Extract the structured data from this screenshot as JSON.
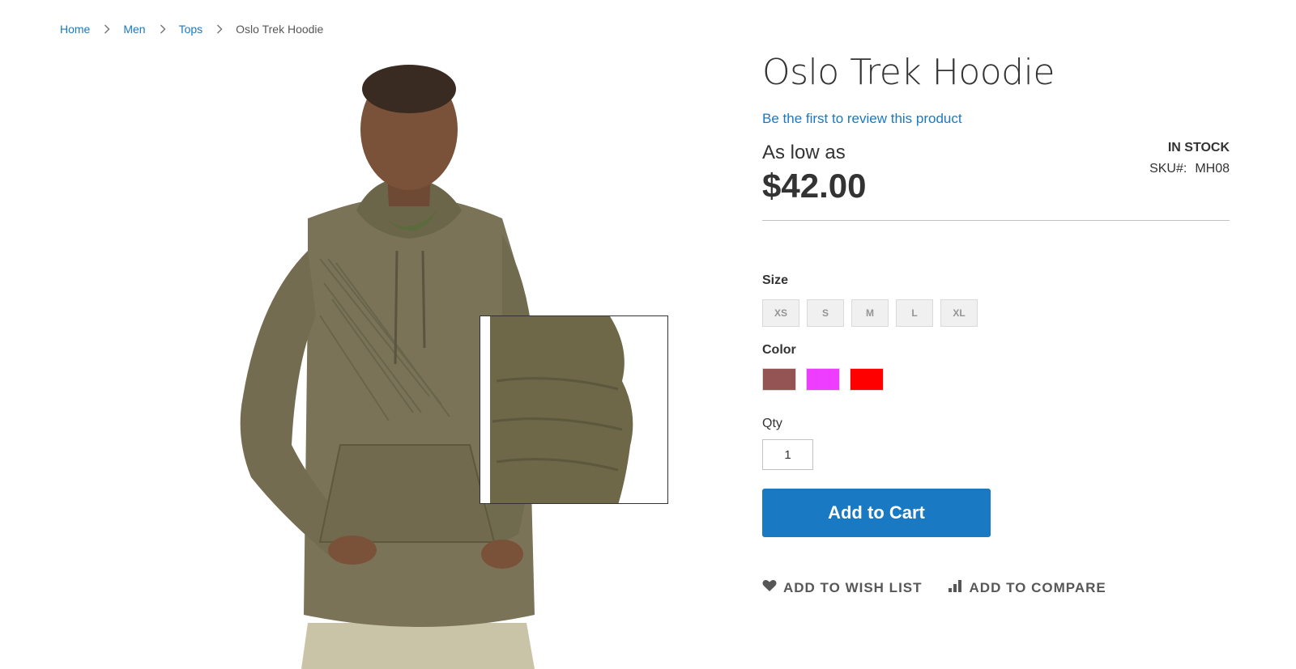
{
  "breadcrumbs": {
    "items": [
      {
        "label": "Home",
        "link": true
      },
      {
        "label": "Men",
        "link": true
      },
      {
        "label": "Tops",
        "link": true
      },
      {
        "label": "Oslo Trek Hoodie",
        "link": false
      }
    ]
  },
  "product": {
    "title": "Oslo Trek Hoodie",
    "review_link": "Be the first to review this product",
    "price_prefix": "As low as",
    "price": "$42.00",
    "stock_status": "In stock",
    "sku_label": "SKU#:",
    "sku_value": "MH08"
  },
  "options": {
    "size_label": "Size",
    "sizes": [
      "XS",
      "S",
      "M",
      "L",
      "XL"
    ],
    "color_label": "Color",
    "colors": [
      "#945454",
      "#ef3dff",
      "#ff0000"
    ]
  },
  "qty": {
    "label": "Qty",
    "value": "1"
  },
  "actions": {
    "add_to_cart": "Add to Cart",
    "wishlist": "Add to Wish List",
    "compare": "Add to Compare"
  },
  "theme": {
    "accent": "#1979c3",
    "hoodie": "#7a7357"
  }
}
